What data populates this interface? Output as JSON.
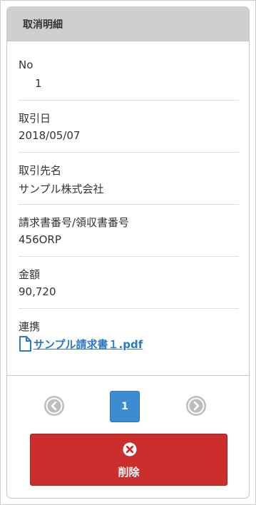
{
  "header": {
    "title": "取消明細"
  },
  "fields": [
    {
      "label": "No",
      "value": "1"
    },
    {
      "label": "取引日",
      "value": "2018/05/07"
    },
    {
      "label": "取引先名",
      "value": "サンプル株式会社"
    },
    {
      "label": "請求書番号/領収書番号",
      "value": "456ORP"
    },
    {
      "label": "金額",
      "value": "90,720"
    }
  ],
  "link_field": {
    "label": "連携",
    "file_name": "サンプル請求書１.pdf",
    "icon": "file-icon"
  },
  "pagination": {
    "current_page": "1",
    "prev_icon": "chevron-left-circle-icon",
    "next_icon": "chevron-right-circle-icon"
  },
  "actions": {
    "delete_label": "削除",
    "delete_icon": "close-circle-icon"
  },
  "colors": {
    "header_bg": "#cfcfcf",
    "page_active": "#3c8dd0",
    "delete_bg": "#cc2d2d",
    "link": "#2f78c4",
    "arrow_gray": "#bdbdbd"
  }
}
